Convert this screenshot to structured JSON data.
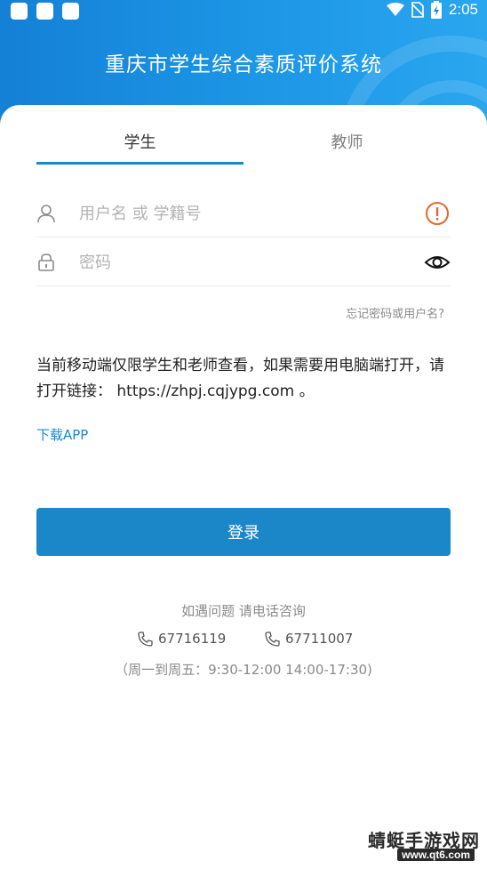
{
  "status_bar": {
    "time": "2:05"
  },
  "header": {
    "title": "重庆市学生综合素质评价系统"
  },
  "tabs": [
    {
      "label": "学生",
      "active": true
    },
    {
      "label": "教师",
      "active": false
    }
  ],
  "login_form": {
    "username_placeholder": "用户名 或 学籍号",
    "username_value": "",
    "password_placeholder": "密码",
    "password_value": "",
    "forgot_link": "忘记密码或用户名?"
  },
  "notice": {
    "text": "当前移动端仅限学生和老师查看，如果需要用电脑端打开，请打开链接： https://zhpj.cqjypg.com 。",
    "download_link": "下载APP"
  },
  "login_button": "登录",
  "support": {
    "title": "如遇问题 请电话咨询",
    "phones": [
      "67716119",
      "67711007"
    ],
    "hours": "（周一到周五：9:30-12:00 14:00-17:30)"
  },
  "watermark": {
    "main": "蜻蜓手游戏网",
    "sub": "www.qt6.com"
  },
  "colors": {
    "primary": "#1b87c9",
    "warning": "#e0692e",
    "header_start": "#1480d6",
    "header_end": "#2aa6ef"
  }
}
